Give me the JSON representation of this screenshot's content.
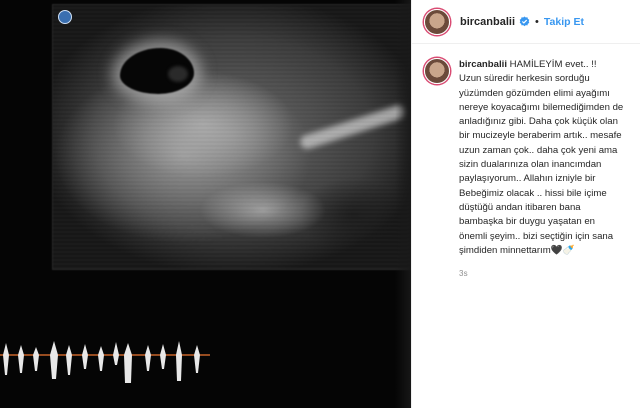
{
  "post": {
    "username": "bircanbalii",
    "follow_label": "Takip Et",
    "separator": "•",
    "caption_lines": [
      "HAMİLEYİM evet.. !!",
      "Uzun süredir herkesin sorduğu",
      "yüzümden gözümden elimi ayağımı",
      "nereye koyacağımı bilemediğimden de",
      "anladığınız gibi. Daha çok küçük olan",
      "bir mucizeyle beraberim artık.. mesafe",
      "uzun zaman çok.. daha çok yeni ama",
      "sizin dualarınıza olan inancımdan",
      "paylaşıyorum.. Allahın izniyle bir",
      "Bebeğimiz olacak .. hissi bile içime",
      "düştüğü andan itibaren bana",
      "bambaşka bir duygu yaşatan en",
      "önemli şeyim.. bizi seçtiğin için sana",
      "şimdiden minnettarım🖤🍼"
    ],
    "time": "3s"
  },
  "icons": {
    "verified": "verified-badge-icon",
    "avatar": "avatar"
  },
  "colors": {
    "link": "#3897f0",
    "text": "#262626",
    "muted": "#8e8e8e",
    "avatar_ring": "#d94b73"
  }
}
